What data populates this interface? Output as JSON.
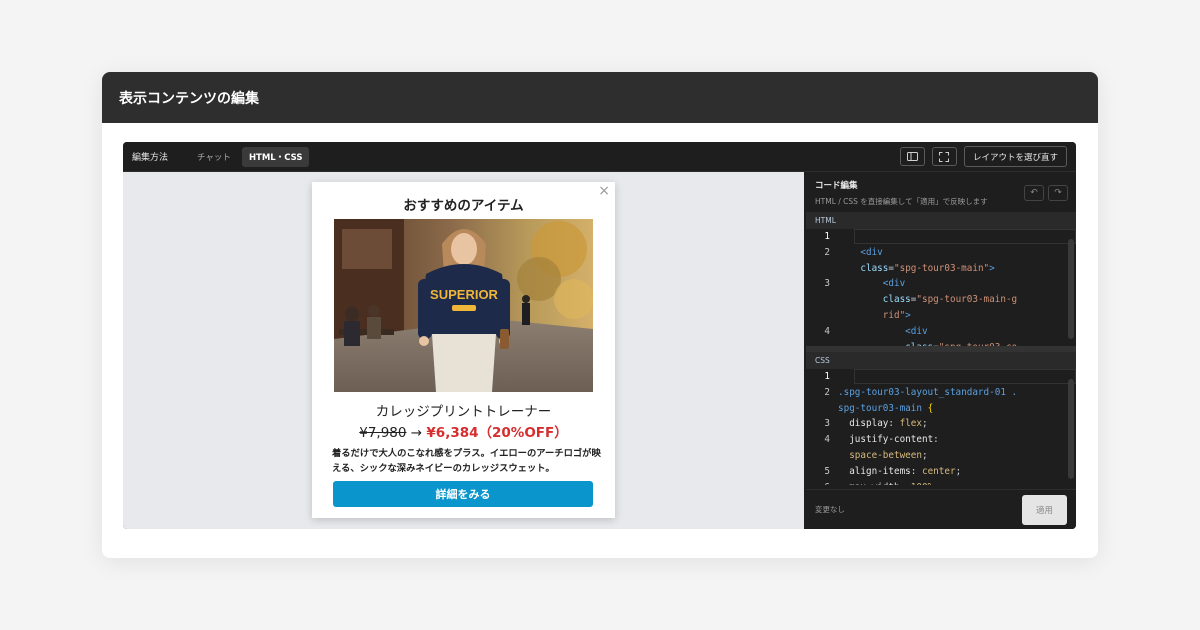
{
  "modal": {
    "title": "表示コンテンツの編集"
  },
  "toolbar": {
    "label": "編集方法",
    "tabs": [
      {
        "label": "チャット",
        "active": false
      },
      {
        "label": "HTML・CSS",
        "active": true
      }
    ],
    "icons": [
      "panel-toggle-icon",
      "fullscreen-icon"
    ],
    "relayout_label": "レイアウトを選び直す"
  },
  "card": {
    "close_glyph": "×",
    "title": "おすすめのアイテム",
    "product_name": "カレッジプリントトレーナー",
    "old_price": "¥7,980",
    "arrow": "→",
    "new_price": "¥6,384（20%OFF）",
    "description": "着るだけで大人のこなれ感をプラス。イエローのアーチロゴが映える、シックな深みネイビーのカレッジスウェット。",
    "cta": "詳細をみる",
    "sweater_print": "SUPERIOR"
  },
  "code_panel": {
    "title": "コード編集",
    "subtitle": "HTML / CSS を直接編集して「適用」で反映します",
    "undo_glyph": "↶",
    "redo_glyph": "↷",
    "html_label": "HTML",
    "css_label": "CSS",
    "status": "変更なし",
    "apply": "適用"
  },
  "colors": {
    "header_bg": "#2e2e2e",
    "editor_bg": "#1e1e1e",
    "preview_bg": "#e8e9ec",
    "cta_bg": "#0a95cc",
    "sale_red": "#d62e2e"
  }
}
